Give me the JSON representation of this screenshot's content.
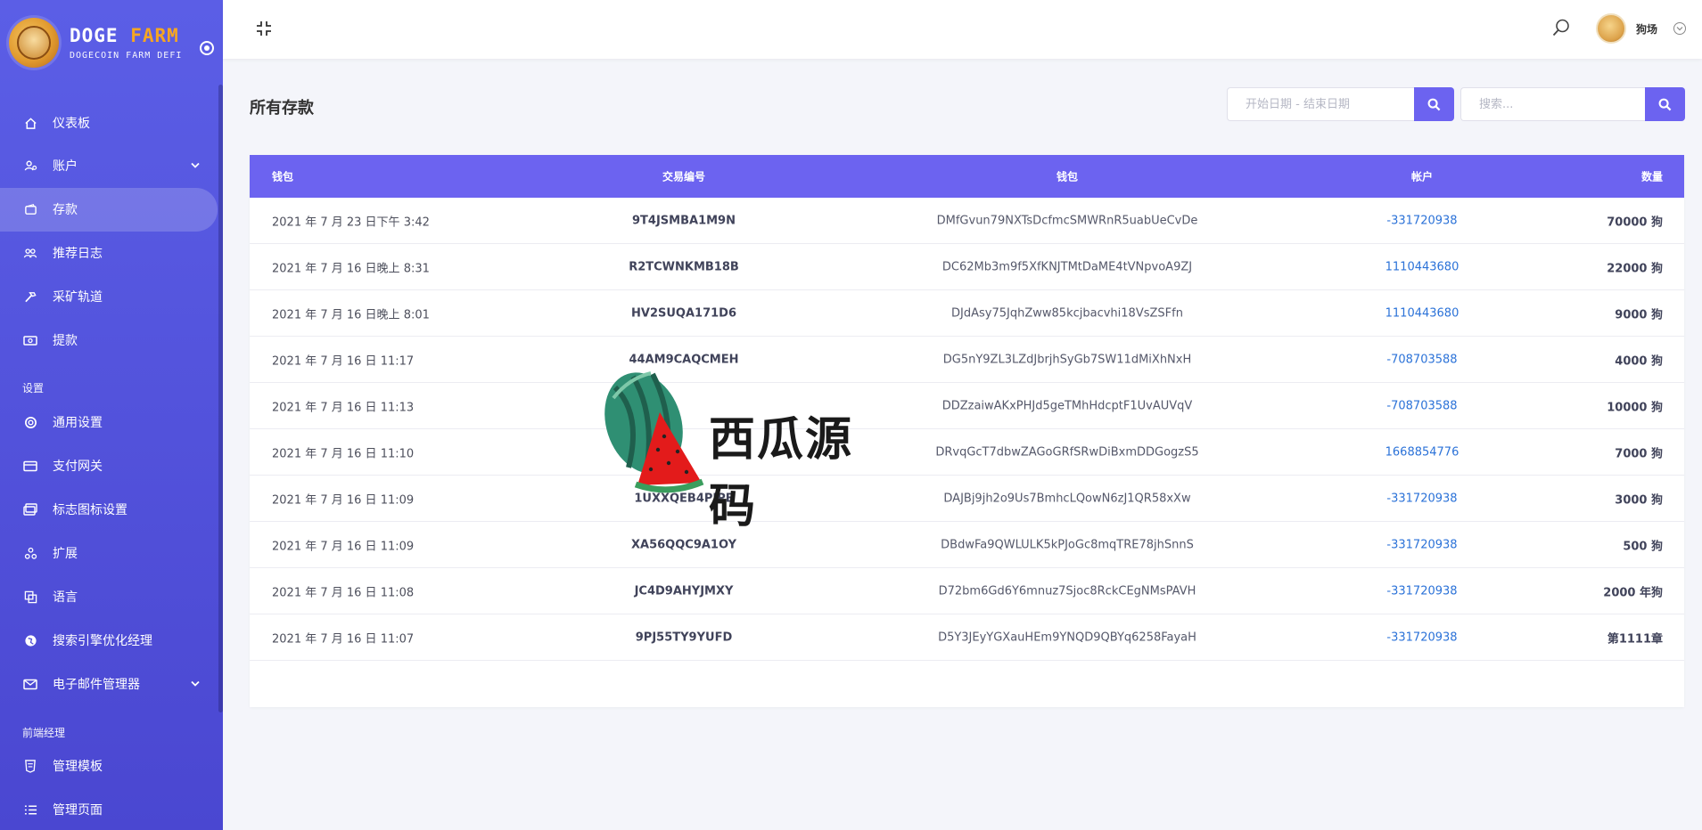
{
  "brand": {
    "title_a": "DOGE",
    "title_b": "FARM",
    "subtitle": "DOGECOIN FARM DEFI"
  },
  "nav": {
    "items": [
      {
        "label": "仪表板",
        "icon": "home-icon"
      },
      {
        "label": "账户",
        "icon": "users-gear-icon",
        "caret": true
      },
      {
        "label": "存款",
        "icon": "wallet-icon",
        "active": true
      },
      {
        "label": "推荐日志",
        "icon": "people-icon"
      },
      {
        "label": "采矿轨道",
        "icon": "hammer-icon"
      },
      {
        "label": "提款",
        "icon": "money-icon"
      }
    ],
    "section_settings": "设置",
    "settings_items": [
      {
        "label": "通用设置",
        "icon": "life-ring-icon"
      },
      {
        "label": "支付网关",
        "icon": "credit-card-icon"
      },
      {
        "label": "标志图标设置",
        "icon": "images-icon"
      },
      {
        "label": "扩展",
        "icon": "puzzle-icon"
      },
      {
        "label": "语言",
        "icon": "language-icon"
      },
      {
        "label": "搜索引擎优化经理",
        "icon": "globe-icon"
      },
      {
        "label": "电子邮件管理器",
        "icon": "envelope-icon",
        "caret": true
      }
    ],
    "section_frontend": "前端经理",
    "frontend_items": [
      {
        "label": "管理模板",
        "icon": "html-icon"
      },
      {
        "label": "管理页面",
        "icon": "list-icon"
      }
    ]
  },
  "topbar": {
    "user_name": "狗场"
  },
  "page": {
    "title": "所有存款",
    "date_placeholder": "开始日期 - 结束日期",
    "search_placeholder": "搜索..."
  },
  "table": {
    "headers": [
      "钱包",
      "交易编号",
      "钱包",
      "帐户",
      "数量"
    ],
    "rows": [
      [
        "2021 年 7 月 23 日下午 3:42",
        "9T4JSMBA1M9N",
        "DMfGvun79NXTsDcfmcSMWRnR5uabUeCvDe",
        "-331720938",
        "70000 狗"
      ],
      [
        "2021 年 7 月 16 日晚上 8:31",
        "R2TCWNKMB18B",
        "DC62Mb3m9f5XfKNJTMtDaME4tVNpvoA9ZJ",
        "1110443680",
        "22000 狗"
      ],
      [
        "2021 年 7 月 16 日晚上 8:01",
        "HV2SUQA171D6",
        "DJdAsy75JqhZww85kcjbacvhi18VsZSFfn",
        "1110443680",
        "9000 狗"
      ],
      [
        "2021 年 7 月 16 日 11:17",
        "44AM9CAQCMEH",
        "DG5nY9ZL3LZdJbrjhSyGb7SW11dMiXhNxH",
        "-708703588",
        "4000 狗"
      ],
      [
        "2021 年 7 月 16 日 11:13",
        "",
        "DDZzaiwAKxPHJd5geTMhHdcptF1UvAUVqV",
        "-708703588",
        "10000 狗"
      ],
      [
        "2021 年 7 月 16 日 11:10",
        "",
        "DRvqGcT7dbwZAGoGRfSRwDiBxmDDGogzS5",
        "1668854776",
        "7000 狗"
      ],
      [
        "2021 年 7 月 16 日 11:09",
        "1UXXQEB4PJPE",
        "DAJBj9jh2o9Us7BmhcLQowN6zJ1QR58xXw",
        "-331720938",
        "3000 狗"
      ],
      [
        "2021 年 7 月 16 日 11:09",
        "XA56QQC9A1OY",
        "DBdwFa9QWLULK5kPJoGc8mqTRE78jhSnnS",
        "-331720938",
        "500 狗"
      ],
      [
        "2021 年 7 月 16 日 11:08",
        "JC4D9AHYJMXY",
        "D72bm6Gd6Y6mnuz7Sjoc8RckCEgNMsPAVH",
        "-331720938",
        "2000 年狗"
      ],
      [
        "2021 年 7 月 16 日 11:07",
        "9PJ55TY9YUFD",
        "D5Y3JEyYGXauHEm9YNQD9QBYq6258FayaH",
        "-331720938",
        "第1111章"
      ]
    ]
  },
  "watermark": {
    "text": "西瓜源码"
  },
  "colors": {
    "sidebar": "#5b5ee6",
    "accent": "#6c63f0",
    "link": "#2b72d8",
    "farm": "#f5a623"
  }
}
